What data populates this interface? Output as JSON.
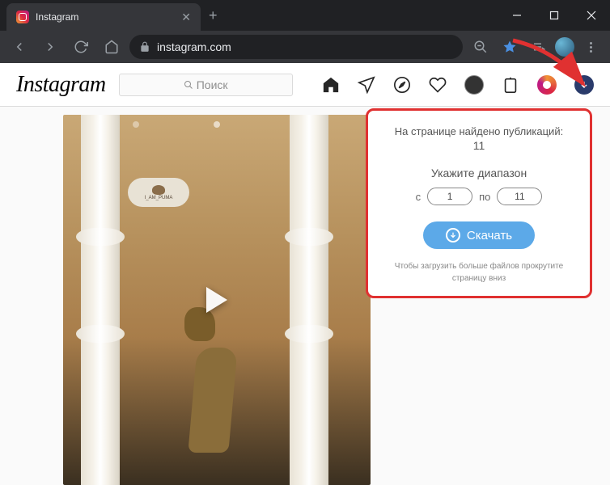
{
  "browser": {
    "tab_title": "Instagram",
    "url": "instagram.com"
  },
  "ig": {
    "logo": "Instagram",
    "search_placeholder": "Поиск"
  },
  "watermark": "I_AM_PUMA",
  "popup": {
    "found_label": "На странице найдено публикаций:",
    "found_count": "11",
    "range_label": "Укажите диапазон",
    "from_label": "с",
    "from_value": "1",
    "to_label": "по",
    "to_value": "11",
    "download_label": "Скачать",
    "hint": "Чтобы загрузить больше файлов прокрутите страницу вниз"
  }
}
